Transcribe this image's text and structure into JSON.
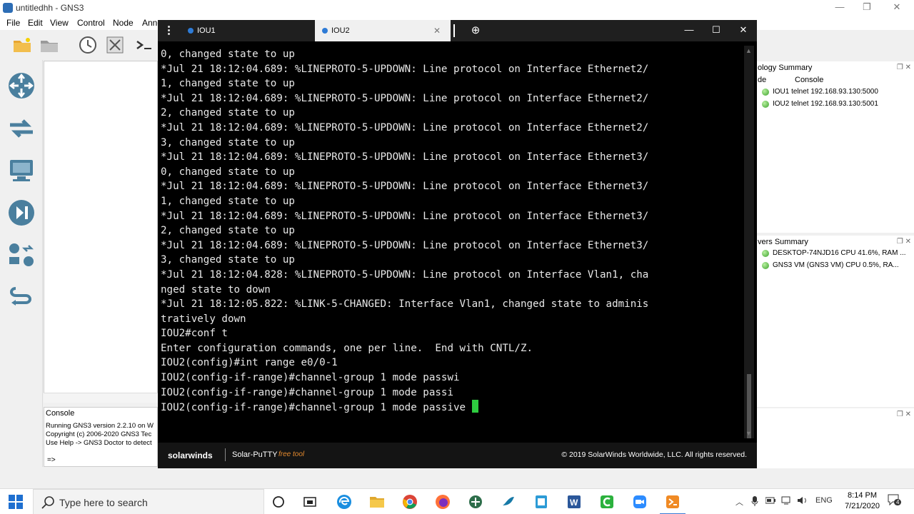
{
  "gns3": {
    "title": "untitledhh - GNS3",
    "menu": [
      "File",
      "Edit",
      "View",
      "Control",
      "Node",
      "Anno"
    ],
    "topology_summary": {
      "title": "ology Summary",
      "col_node": "de",
      "col_console": "Console",
      "rows": [
        {
          "name": "IOU1",
          "console": "telnet 192.168.93.130:5000"
        },
        {
          "name": "IOU2",
          "console": "telnet 192.168.93.130:5001"
        }
      ]
    },
    "servers_summary": {
      "title": "vers Summary",
      "rows": [
        "DESKTOP-74NJD16 CPU 41.6%, RAM ...",
        "GNS3 VM (GNS3 VM) CPU 0.5%, RA..."
      ]
    },
    "console": {
      "title": "Console",
      "lines": [
        "Running GNS3 version 2.2.10 on W",
        "Copyright (c) 2006-2020 GNS3 Tec",
        "Use Help -> GNS3 Doctor to detect"
      ],
      "prompt": "=>"
    }
  },
  "putty": {
    "tabs": [
      {
        "label": "IOU1"
      },
      {
        "label": "IOU2"
      }
    ],
    "terminal_lines": [
      "0, changed state to up",
      "*Jul 21 18:12:04.689: %LINEPROTO-5-UPDOWN: Line protocol on Interface Ethernet2/",
      "1, changed state to up",
      "*Jul 21 18:12:04.689: %LINEPROTO-5-UPDOWN: Line protocol on Interface Ethernet2/",
      "2, changed state to up",
      "*Jul 21 18:12:04.689: %LINEPROTO-5-UPDOWN: Line protocol on Interface Ethernet2/",
      "3, changed state to up",
      "*Jul 21 18:12:04.689: %LINEPROTO-5-UPDOWN: Line protocol on Interface Ethernet3/",
      "0, changed state to up",
      "*Jul 21 18:12:04.689: %LINEPROTO-5-UPDOWN: Line protocol on Interface Ethernet3/",
      "1, changed state to up",
      "*Jul 21 18:12:04.689: %LINEPROTO-5-UPDOWN: Line protocol on Interface Ethernet3/",
      "2, changed state to up",
      "*Jul 21 18:12:04.689: %LINEPROTO-5-UPDOWN: Line protocol on Interface Ethernet3/",
      "3, changed state to up",
      "*Jul 21 18:12:04.828: %LINEPROTO-5-UPDOWN: Line protocol on Interface Vlan1, cha",
      "nged state to down",
      "*Jul 21 18:12:05.822: %LINK-5-CHANGED: Interface Vlan1, changed state to adminis",
      "tratively down",
      "IOU2#conf t",
      "Enter configuration commands, one per line.  End with CNTL/Z.",
      "IOU2(config)#int range e0/0-1",
      "IOU2(config-if-range)#channel-group 1 mode passwi",
      "IOU2(config-if-range)#channel-group 1 mode passi"
    ],
    "current_line": "IOU2(config-if-range)#channel-group 1 mode passive ",
    "footer": {
      "brand": "solarwinds",
      "product": "Solar-PuTTY",
      "free": "free tool",
      "copyright": "© 2019 SolarWinds Worldwide, LLC. All rights reserved."
    }
  },
  "taskbar": {
    "search_placeholder": "Type here to search",
    "lang": "ENG",
    "time": "8:14 PM",
    "date": "7/21/2020",
    "notifications": "4"
  }
}
